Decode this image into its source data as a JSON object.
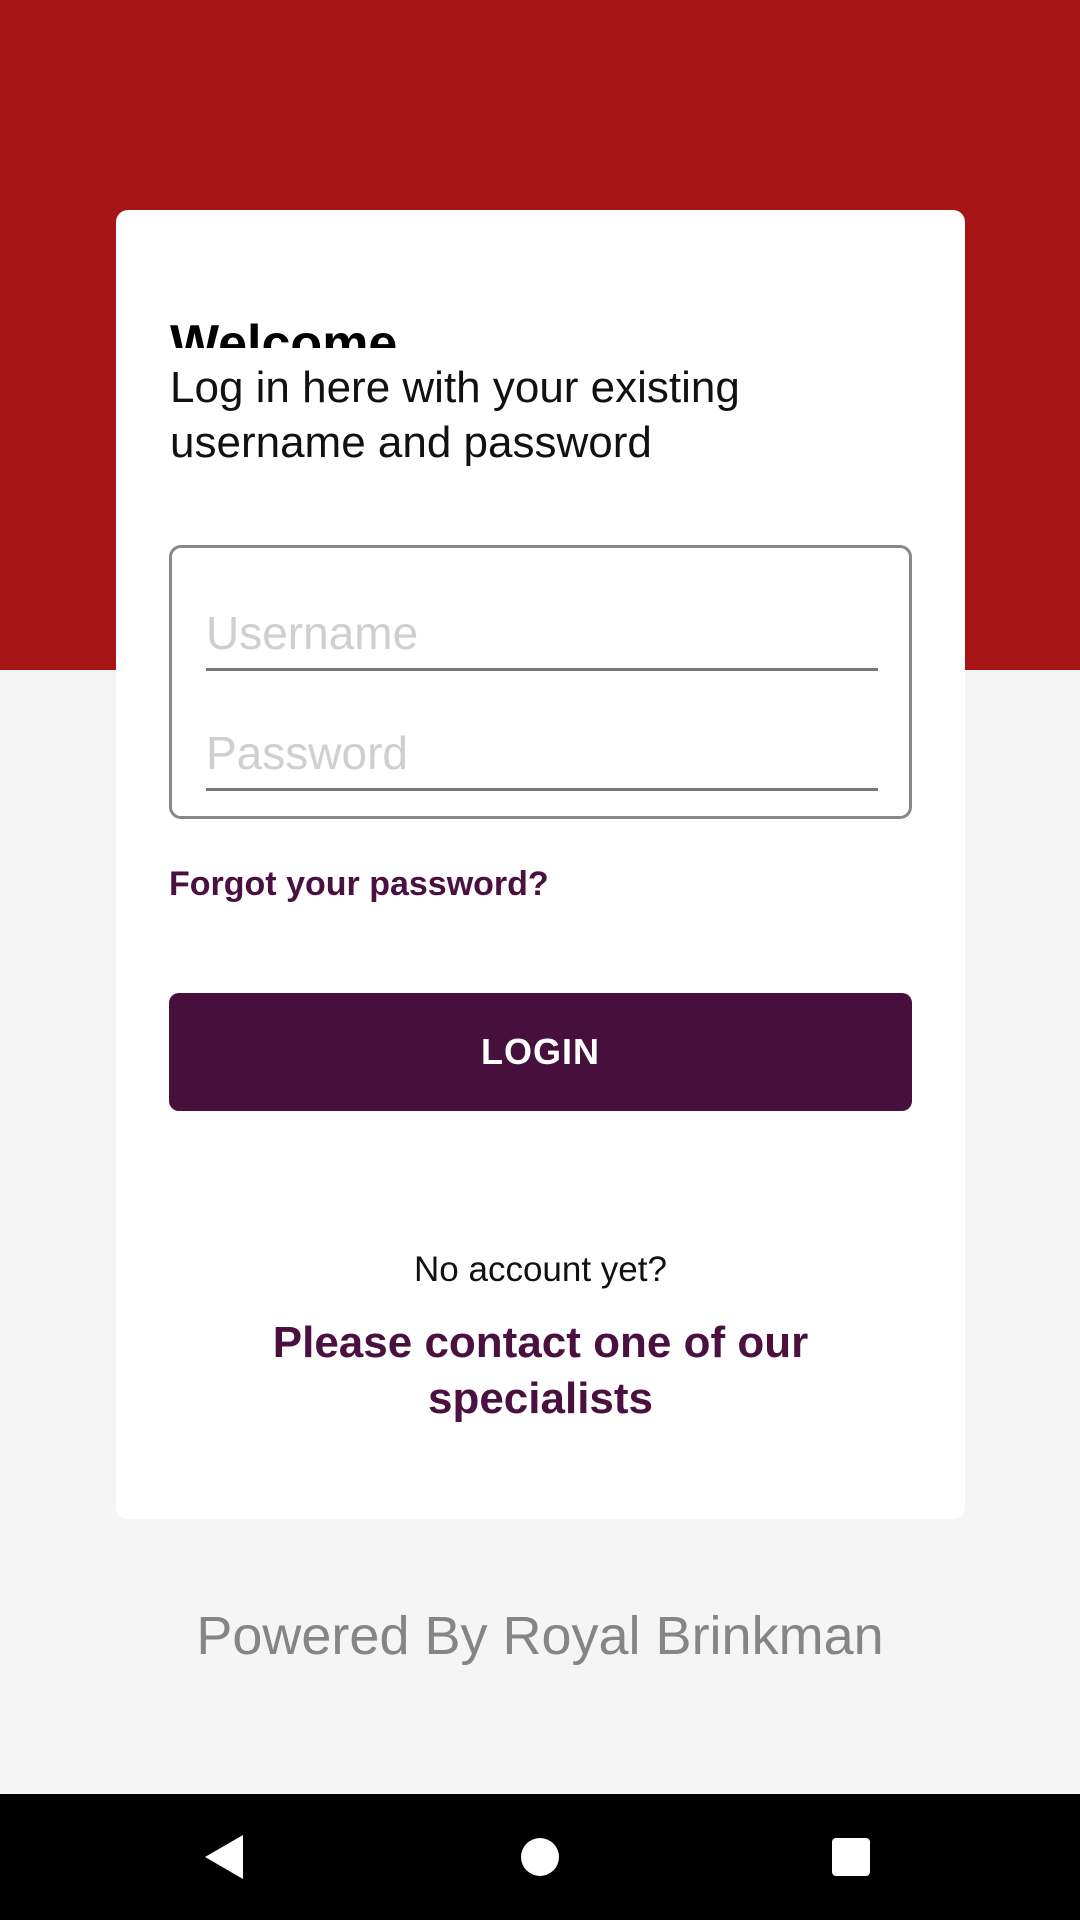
{
  "colors": {
    "header_red": "#a71517",
    "accent_purple": "#47103c",
    "background": "#f5f5f5"
  },
  "login_card": {
    "welcome": "Welcome",
    "subtitle": "Log in here with your existing username and password",
    "username_placeholder": "Username",
    "password_placeholder": "Password",
    "forgot_password": "Forgot your password?",
    "login_label": "LOGIN",
    "no_account": "No account yet?",
    "contact_link": "Please contact one of our specialists"
  },
  "footer": {
    "powered_by": "Powered By Royal Brinkman"
  },
  "navbar": {
    "back_icon": "back-triangle-icon",
    "home_icon": "home-circle-icon",
    "recents_icon": "recents-square-icon"
  }
}
